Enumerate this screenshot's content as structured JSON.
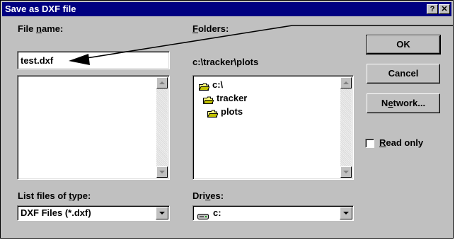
{
  "window": {
    "title": "Save as DXF file",
    "help_glyph": "?",
    "close_glyph": "✕"
  },
  "filename": {
    "label": "File name:",
    "value": "test.dxf"
  },
  "folders": {
    "label": "Folders:",
    "current_path": "c:\\tracker\\plots",
    "tree": [
      "c:\\",
      "tracker",
      "plots"
    ]
  },
  "filetype": {
    "label": "List files of type:",
    "selected": "DXF Files (*.dxf)"
  },
  "drives": {
    "label": "Drives:",
    "selected": "c:"
  },
  "buttons": {
    "ok": "OK",
    "cancel": "Cancel",
    "network": "Network..."
  },
  "readonly": {
    "label": "Read only",
    "checked": false
  },
  "colors": {
    "titlebar": "#000080",
    "face": "#c0c0c0"
  }
}
